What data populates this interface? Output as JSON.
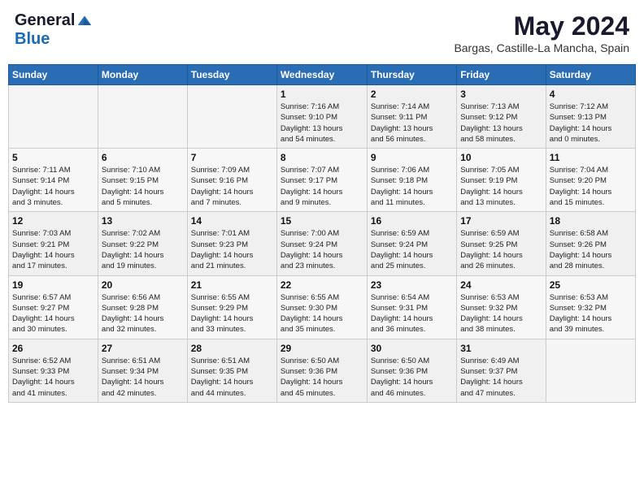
{
  "header": {
    "logo_general": "General",
    "logo_blue": "Blue",
    "title": "May 2024",
    "location": "Bargas, Castille-La Mancha, Spain"
  },
  "days_of_week": [
    "Sunday",
    "Monday",
    "Tuesday",
    "Wednesday",
    "Thursday",
    "Friday",
    "Saturday"
  ],
  "weeks": [
    [
      {
        "day": "",
        "empty": true
      },
      {
        "day": "",
        "empty": true
      },
      {
        "day": "",
        "empty": true
      },
      {
        "day": "1",
        "sunrise": "7:16 AM",
        "sunset": "9:10 PM",
        "daylight": "13 hours and 54 minutes."
      },
      {
        "day": "2",
        "sunrise": "7:14 AM",
        "sunset": "9:11 PM",
        "daylight": "13 hours and 56 minutes."
      },
      {
        "day": "3",
        "sunrise": "7:13 AM",
        "sunset": "9:12 PM",
        "daylight": "13 hours and 58 minutes."
      },
      {
        "day": "4",
        "sunrise": "7:12 AM",
        "sunset": "9:13 PM",
        "daylight": "14 hours and 0 minutes."
      }
    ],
    [
      {
        "day": "5",
        "sunrise": "7:11 AM",
        "sunset": "9:14 PM",
        "daylight": "14 hours and 3 minutes."
      },
      {
        "day": "6",
        "sunrise": "7:10 AM",
        "sunset": "9:15 PM",
        "daylight": "14 hours and 5 minutes."
      },
      {
        "day": "7",
        "sunrise": "7:09 AM",
        "sunset": "9:16 PM",
        "daylight": "14 hours and 7 minutes."
      },
      {
        "day": "8",
        "sunrise": "7:07 AM",
        "sunset": "9:17 PM",
        "daylight": "14 hours and 9 minutes."
      },
      {
        "day": "9",
        "sunrise": "7:06 AM",
        "sunset": "9:18 PM",
        "daylight": "14 hours and 11 minutes."
      },
      {
        "day": "10",
        "sunrise": "7:05 AM",
        "sunset": "9:19 PM",
        "daylight": "14 hours and 13 minutes."
      },
      {
        "day": "11",
        "sunrise": "7:04 AM",
        "sunset": "9:20 PM",
        "daylight": "14 hours and 15 minutes."
      }
    ],
    [
      {
        "day": "12",
        "sunrise": "7:03 AM",
        "sunset": "9:21 PM",
        "daylight": "14 hours and 17 minutes."
      },
      {
        "day": "13",
        "sunrise": "7:02 AM",
        "sunset": "9:22 PM",
        "daylight": "14 hours and 19 minutes."
      },
      {
        "day": "14",
        "sunrise": "7:01 AM",
        "sunset": "9:23 PM",
        "daylight": "14 hours and 21 minutes."
      },
      {
        "day": "15",
        "sunrise": "7:00 AM",
        "sunset": "9:24 PM",
        "daylight": "14 hours and 23 minutes."
      },
      {
        "day": "16",
        "sunrise": "6:59 AM",
        "sunset": "9:24 PM",
        "daylight": "14 hours and 25 minutes."
      },
      {
        "day": "17",
        "sunrise": "6:59 AM",
        "sunset": "9:25 PM",
        "daylight": "14 hours and 26 minutes."
      },
      {
        "day": "18",
        "sunrise": "6:58 AM",
        "sunset": "9:26 PM",
        "daylight": "14 hours and 28 minutes."
      }
    ],
    [
      {
        "day": "19",
        "sunrise": "6:57 AM",
        "sunset": "9:27 PM",
        "daylight": "14 hours and 30 minutes."
      },
      {
        "day": "20",
        "sunrise": "6:56 AM",
        "sunset": "9:28 PM",
        "daylight": "14 hours and 32 minutes."
      },
      {
        "day": "21",
        "sunrise": "6:55 AM",
        "sunset": "9:29 PM",
        "daylight": "14 hours and 33 minutes."
      },
      {
        "day": "22",
        "sunrise": "6:55 AM",
        "sunset": "9:30 PM",
        "daylight": "14 hours and 35 minutes."
      },
      {
        "day": "23",
        "sunrise": "6:54 AM",
        "sunset": "9:31 PM",
        "daylight": "14 hours and 36 minutes."
      },
      {
        "day": "24",
        "sunrise": "6:53 AM",
        "sunset": "9:32 PM",
        "daylight": "14 hours and 38 minutes."
      },
      {
        "day": "25",
        "sunrise": "6:53 AM",
        "sunset": "9:32 PM",
        "daylight": "14 hours and 39 minutes."
      }
    ],
    [
      {
        "day": "26",
        "sunrise": "6:52 AM",
        "sunset": "9:33 PM",
        "daylight": "14 hours and 41 minutes."
      },
      {
        "day": "27",
        "sunrise": "6:51 AM",
        "sunset": "9:34 PM",
        "daylight": "14 hours and 42 minutes."
      },
      {
        "day": "28",
        "sunrise": "6:51 AM",
        "sunset": "9:35 PM",
        "daylight": "14 hours and 44 minutes."
      },
      {
        "day": "29",
        "sunrise": "6:50 AM",
        "sunset": "9:36 PM",
        "daylight": "14 hours and 45 minutes."
      },
      {
        "day": "30",
        "sunrise": "6:50 AM",
        "sunset": "9:36 PM",
        "daylight": "14 hours and 46 minutes."
      },
      {
        "day": "31",
        "sunrise": "6:49 AM",
        "sunset": "9:37 PM",
        "daylight": "14 hours and 47 minutes."
      },
      {
        "day": "",
        "empty": true
      }
    ]
  ]
}
